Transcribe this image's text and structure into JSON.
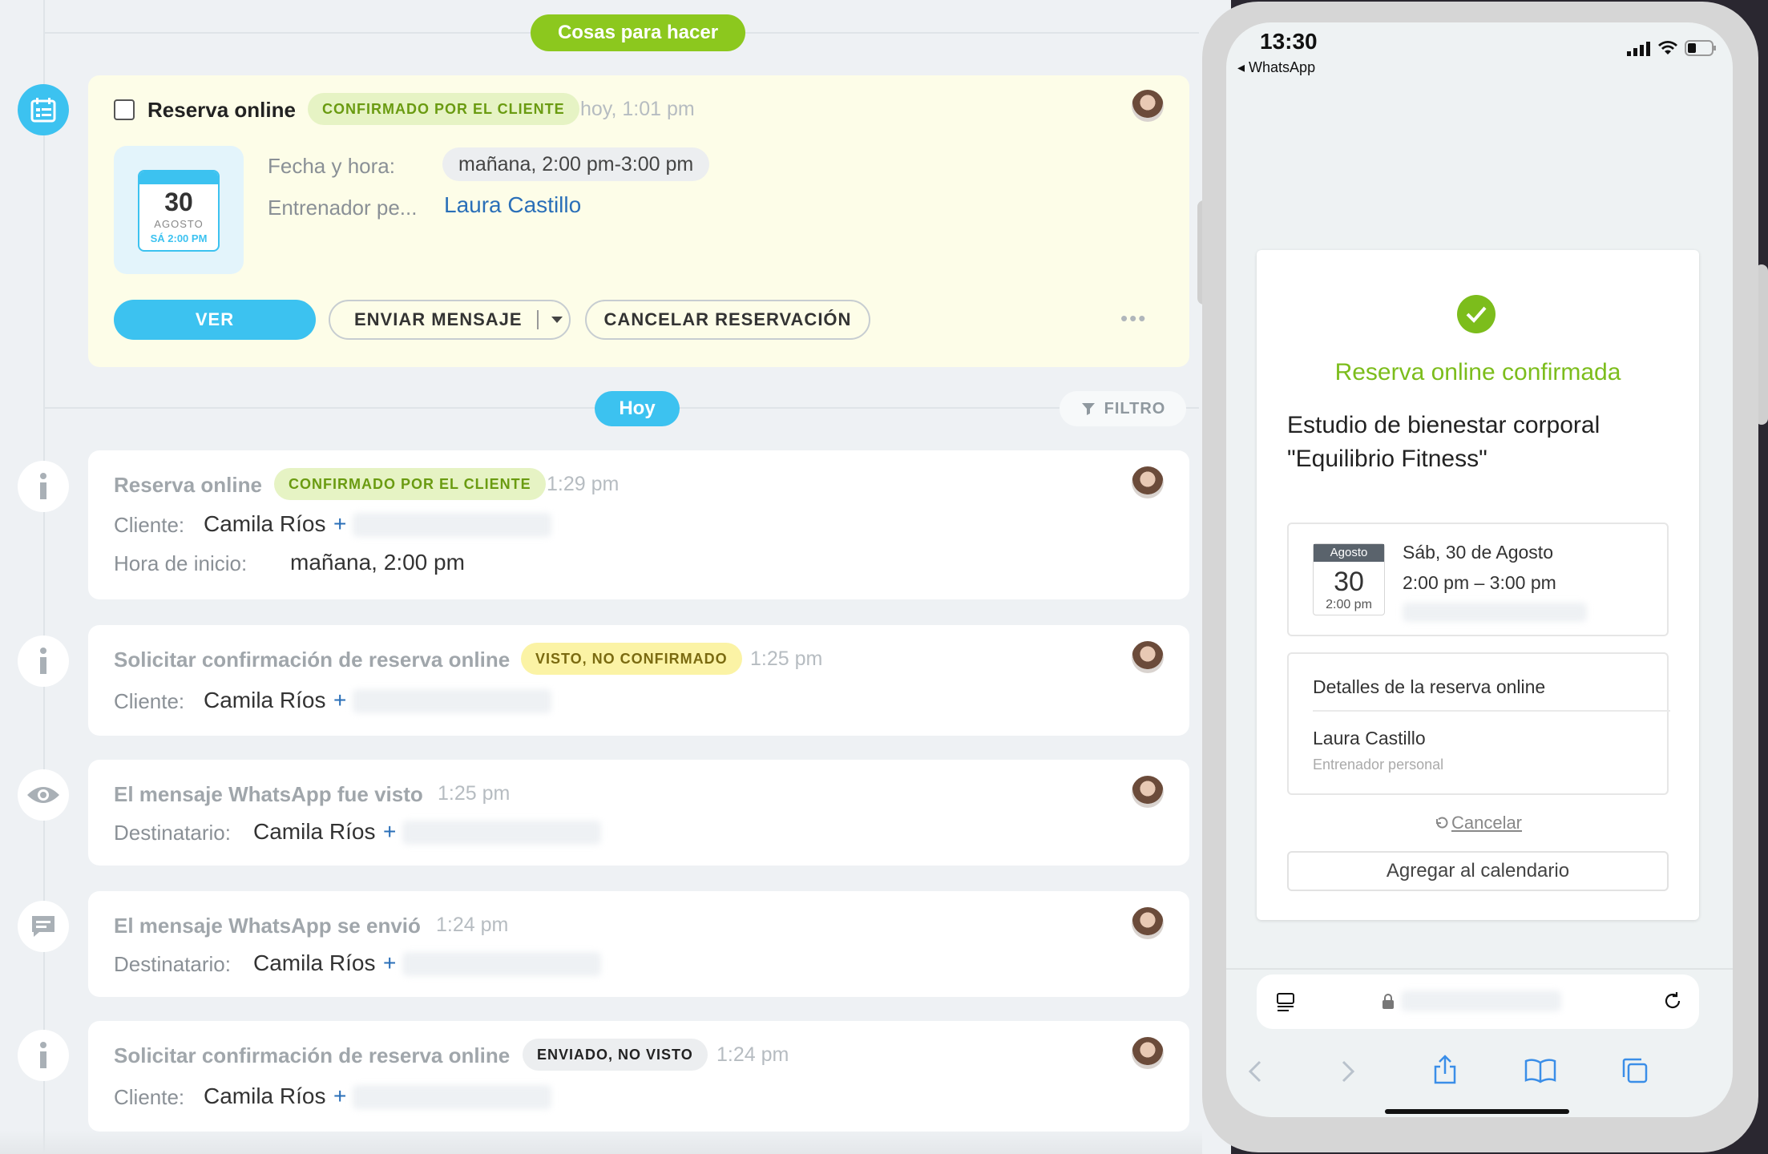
{
  "timeline": {
    "section_todo": "Cosas para hacer",
    "section_today": "Hoy",
    "filter_label": "FILTRO"
  },
  "todo_card": {
    "title": "Reserva online",
    "badge": "CONFIRMADO POR EL CLIENTE",
    "time": "hoy, 1:01 pm",
    "calendar": {
      "day": "30",
      "month": "AGOSTO",
      "weekday_time": "SÁ 2:00 PM"
    },
    "date_label": "Fecha y hora:",
    "date_value": "mañana, 2:00 pm-3:00 pm",
    "trainer_label": "Entrenador pe...",
    "trainer_value": "Laura Castillo",
    "btn_view": "VER",
    "btn_message": "ENVIAR MENSAJE",
    "btn_cancel": "CANCELAR RESERVACIÓN",
    "more": "•••"
  },
  "events": [
    {
      "title": "Reserva online",
      "badge": "CONFIRMADO POR EL CLIENTE",
      "badge_color": "green",
      "time": "1:29 pm",
      "label1": "Cliente:",
      "value1": "Camila Ríos",
      "label2": "Hora de inicio:",
      "value2": "mañana, 2:00 pm",
      "icon": "info-icon"
    },
    {
      "title": "Solicitar confirmación de reserva online",
      "badge": "VISTO, NO CONFIRMADO",
      "badge_color": "yellow",
      "time": "1:25 pm",
      "label1": "Cliente:",
      "value1": "Camila Ríos",
      "icon": "info-icon"
    },
    {
      "title": "El mensaje WhatsApp fue visto",
      "time": "1:25 pm",
      "label1": "Destinatario:",
      "value1": "Camila Ríos",
      "icon": "eye-icon"
    },
    {
      "title": "El mensaje WhatsApp se envió",
      "time": "1:24 pm",
      "label1": "Destinatario:",
      "value1": "Camila Ríos",
      "icon": "chat-icon"
    },
    {
      "title": "Solicitar confirmación de reserva online",
      "badge": "ENVIADO, NO VISTO",
      "badge_color": "grey",
      "time": "1:24 pm",
      "label1": "Cliente:",
      "value1": "Camila Ríos",
      "icon": "info-icon"
    }
  ],
  "plus": "+",
  "phone": {
    "status_time": "13:30",
    "back_app": "◂ WhatsApp",
    "confirmed_title": "Reserva online confirmada",
    "studio_line1": "Estudio de bienestar corporal",
    "studio_line2": "\"Equilibrio Fitness\"",
    "cal_month": "Agosto",
    "cal_day": "30",
    "cal_time": "2:00 pm",
    "date_text": "Sáb, 30 de Agosto",
    "time_range": "2:00 pm – 3:00 pm",
    "details_title": "Detalles de la reserva online",
    "trainer_name": "Laura Castillo",
    "trainer_role": "Entrenador personal",
    "cancel_link": "Cancelar",
    "add_calendar": "Agregar al calendario"
  },
  "colors": {
    "accent_blue": "#3cc2f0",
    "accent_green": "#8cc81e",
    "link_blue": "#2a6fb8"
  }
}
